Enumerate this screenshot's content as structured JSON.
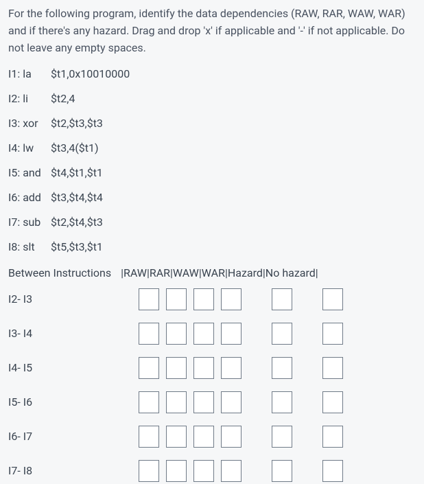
{
  "intro": "For the following program, identify the data dependencies (RAW, RAR, WAW, WAR) and if there's any hazard. Drag and drop 'x' if applicable and '-' if not applicable. Do not leave any empty spaces.",
  "instructions": [
    {
      "label": "I1: la",
      "operands": "$t1,0x10010000"
    },
    {
      "label": "I2: li",
      "operands": "$t2,4"
    },
    {
      "label": "I3: xor",
      "operands": "$t2,$t3,$t3"
    },
    {
      "label": "I4: lw",
      "operands": "$t3,4($t1)"
    },
    {
      "label": "I5: and",
      "operands": "$t4,$t1,$t1"
    },
    {
      "label": "I6: add",
      "operands": "$t3,$t4,$t4"
    },
    {
      "label": "I7: sub",
      "operands": "$t2,$t4,$t3"
    },
    {
      "label": "I8: slt",
      "operands": "$t5,$t3,$t1"
    }
  ],
  "header": {
    "left": "Between Instructions",
    "right": "|RAW|RAR|WAW|WAR|Hazard|No hazard|"
  },
  "pairs": [
    {
      "label": "I2- I3"
    },
    {
      "label": "I3- I4"
    },
    {
      "label": "I4- I5"
    },
    {
      "label": "I5- I6"
    },
    {
      "label": "I6- I7"
    },
    {
      "label": "I7- I8"
    }
  ],
  "columns": [
    "RAW",
    "RAR",
    "WAW",
    "WAR",
    "Hazard",
    "No hazard"
  ]
}
